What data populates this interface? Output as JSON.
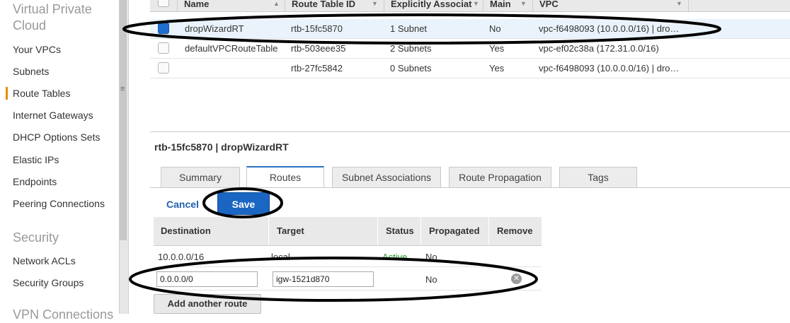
{
  "sidebar": {
    "heading": "Virtual Private Cloud",
    "items": [
      {
        "label": "Your VPCs"
      },
      {
        "label": "Subnets"
      },
      {
        "label": "Route Tables"
      },
      {
        "label": "Internet Gateways"
      },
      {
        "label": "DHCP Options Sets"
      },
      {
        "label": "Elastic IPs"
      },
      {
        "label": "Endpoints"
      },
      {
        "label": "Peering Connections"
      }
    ],
    "security_heading": "Security",
    "security_items": [
      {
        "label": "Network ACLs"
      },
      {
        "label": "Security Groups"
      }
    ],
    "next_heading": "VPN Connections"
  },
  "table": {
    "columns": [
      "Name",
      "Route Table ID",
      "Explicitly Associat",
      "Main",
      "VPC"
    ],
    "rows": [
      {
        "name": "dropWizardRT",
        "id": "rtb-15fc5870",
        "assoc": "1 Subnet",
        "main": "No",
        "vpc": "vpc-f6498093 (10.0.0.0/16) | dro…",
        "selected": true
      },
      {
        "name": "defaultVPCRouteTable",
        "id": "rtb-503eee35",
        "assoc": "2 Subnets",
        "main": "Yes",
        "vpc": "vpc-ef02c38a (172.31.0.0/16)",
        "selected": false
      },
      {
        "name": "",
        "id": "rtb-27fc5842",
        "assoc": "0 Subnets",
        "main": "Yes",
        "vpc": "vpc-f6498093 (10.0.0.0/16) | dro…",
        "selected": false
      }
    ]
  },
  "detail": {
    "title": "rtb-15fc5870 | dropWizardRT",
    "tabs": [
      "Summary",
      "Routes",
      "Subnet Associations",
      "Route Propagation",
      "Tags"
    ],
    "cancel_label": "Cancel",
    "save_label": "Save",
    "route_columns": [
      "Destination",
      "Target",
      "Status",
      "Propagated",
      "Remove"
    ],
    "route_rows": [
      {
        "destination": "10.0.0.0/16",
        "target": "local",
        "status": "Active",
        "propagated": "No"
      }
    ],
    "new_route": {
      "destination": "0.0.0.0/0",
      "target": "igw-1521d870",
      "propagated": "No"
    },
    "add_route_label": "Add another route"
  },
  "colors": {
    "accent": "#1a66c2",
    "active_nav": "#e88c00",
    "status_active": "#2e9b2e"
  }
}
